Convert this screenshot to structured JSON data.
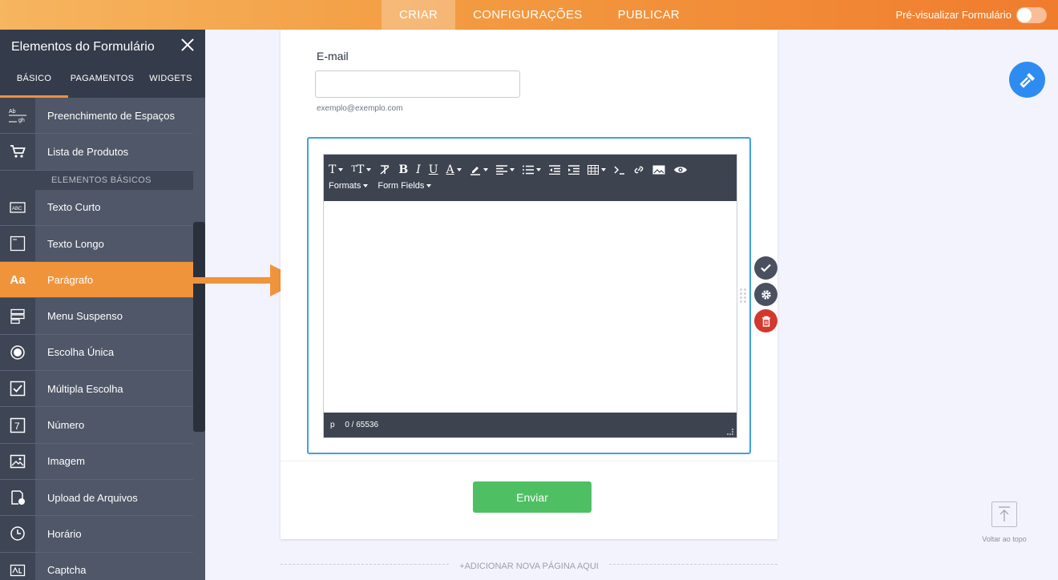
{
  "topbar": {
    "tabs": [
      "CRIAR",
      "CONFIGURAÇÕES",
      "PUBLICAR"
    ],
    "active_tab": "CRIAR",
    "preview_label": "Pré-visualizar Formulário"
  },
  "sidebar": {
    "title": "Elementos do Formulário",
    "tabs": [
      "BÁSICO",
      "PAGAMENTOS",
      "WIDGETS"
    ],
    "items": [
      {
        "label": "Preenchimento de Espaços",
        "icon": "fill-in-blank-icon"
      },
      {
        "label": "Lista de Produtos",
        "icon": "shopping-cart-icon"
      },
      {
        "label": "Texto Curto",
        "icon": "short-text-icon"
      },
      {
        "label": "Texto Longo",
        "icon": "long-text-icon"
      },
      {
        "label": "Parágrafo",
        "icon": "paragraph-icon",
        "icon_text": "Aa"
      },
      {
        "label": "Menu Suspenso",
        "icon": "dropdown-icon"
      },
      {
        "label": "Escolha Única",
        "icon": "radio-icon"
      },
      {
        "label": "Múltipla Escolha",
        "icon": "checkbox-icon"
      },
      {
        "label": "Número",
        "icon": "number-icon",
        "icon_text": "7"
      },
      {
        "label": "Imagem",
        "icon": "image-icon"
      },
      {
        "label": "Upload de Arquivos",
        "icon": "file-upload-icon"
      },
      {
        "label": "Horário",
        "icon": "clock-icon"
      },
      {
        "label": "Captcha",
        "icon": "captcha-icon"
      }
    ],
    "section_label": "ELEMENTOS BÁSICOS",
    "fill_icon_text": {
      "top": "Ab",
      "bottom": "gh"
    },
    "short_text_icon_text": "ABC"
  },
  "form": {
    "email_label": "E-mail",
    "email_value": "",
    "email_sublabel": "exemplo@exemplo.com",
    "editor": {
      "menus": [
        "Formats",
        "Form Fields"
      ],
      "status_path": "p",
      "char_count": "0 / 65536"
    },
    "submit_label": "Enviar",
    "add_page_label": "+ADICIONAR NOVA PÁGINA AQUI"
  },
  "back_to_top_label": "Voltar ao topo",
  "colors": {
    "accent_orange": "#f0943c",
    "sidebar_bg": "#4f5768",
    "submit_green": "#4fbf63",
    "selection_blue": "#3fa1e0",
    "delete_red": "#d1392e",
    "paint_blue": "#2e8cf0"
  }
}
